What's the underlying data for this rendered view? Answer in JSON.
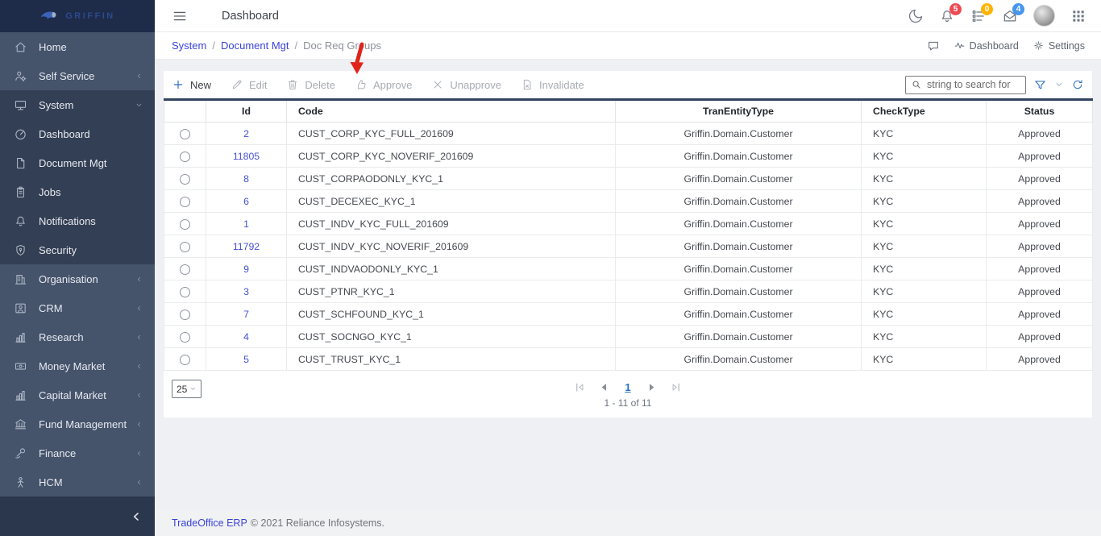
{
  "brand": {
    "name": "GRIFFIN"
  },
  "header": {
    "title": "Dashboard",
    "badges": {
      "notifications": "5",
      "tasks": "0",
      "messages": "4"
    }
  },
  "breadcrumb": {
    "separator": "/",
    "items": [
      {
        "label": "System",
        "link": true
      },
      {
        "label": "Document Mgt",
        "link": true
      },
      {
        "label": "Doc Req Groups",
        "link": false
      }
    ]
  },
  "quick_links": {
    "dashboard": "Dashboard",
    "settings": "Settings"
  },
  "toolbar": {
    "buttons": [
      {
        "label": "New",
        "icon": "plus-icon",
        "enabled": true
      },
      {
        "label": "Edit",
        "icon": "pencil-icon",
        "enabled": false
      },
      {
        "label": "Delete",
        "icon": "trash-icon",
        "enabled": false
      },
      {
        "label": "Approve",
        "icon": "thumbs-up-icon",
        "enabled": false
      },
      {
        "label": "Unapprove",
        "icon": "x-icon",
        "enabled": false
      },
      {
        "label": "Invalidate",
        "icon": "file-x-icon",
        "enabled": false
      }
    ],
    "search_placeholder": "string to search for"
  },
  "table": {
    "columns": [
      "",
      "Id",
      "Code",
      "TranEntityType",
      "CheckType",
      "Status"
    ],
    "rows": [
      {
        "id": "2",
        "code": "CUST_CORP_KYC_FULL_201609",
        "tran_entity_type": "Griffin.Domain.Customer",
        "check_type": "KYC",
        "status": "Approved"
      },
      {
        "id": "11805",
        "code": "CUST_CORP_KYC_NOVERIF_201609",
        "tran_entity_type": "Griffin.Domain.Customer",
        "check_type": "KYC",
        "status": "Approved"
      },
      {
        "id": "8",
        "code": "CUST_CORPAODONLY_KYC_1",
        "tran_entity_type": "Griffin.Domain.Customer",
        "check_type": "KYC",
        "status": "Approved"
      },
      {
        "id": "6",
        "code": "CUST_DECEXEC_KYC_1",
        "tran_entity_type": "Griffin.Domain.Customer",
        "check_type": "KYC",
        "status": "Approved"
      },
      {
        "id": "1",
        "code": "CUST_INDV_KYC_FULL_201609",
        "tran_entity_type": "Griffin.Domain.Customer",
        "check_type": "KYC",
        "status": "Approved"
      },
      {
        "id": "11792",
        "code": "CUST_INDV_KYC_NOVERIF_201609",
        "tran_entity_type": "Griffin.Domain.Customer",
        "check_type": "KYC",
        "status": "Approved"
      },
      {
        "id": "9",
        "code": "CUST_INDVAODONLY_KYC_1",
        "tran_entity_type": "Griffin.Domain.Customer",
        "check_type": "KYC",
        "status": "Approved"
      },
      {
        "id": "3",
        "code": "CUST_PTNR_KYC_1",
        "tran_entity_type": "Griffin.Domain.Customer",
        "check_type": "KYC",
        "status": "Approved"
      },
      {
        "id": "7",
        "code": "CUST_SCHFOUND_KYC_1",
        "tran_entity_type": "Griffin.Domain.Customer",
        "check_type": "KYC",
        "status": "Approved"
      },
      {
        "id": "4",
        "code": "CUST_SOCNGO_KYC_1",
        "tran_entity_type": "Griffin.Domain.Customer",
        "check_type": "KYC",
        "status": "Approved"
      },
      {
        "id": "5",
        "code": "CUST_TRUST_KYC_1",
        "tran_entity_type": "Griffin.Domain.Customer",
        "check_type": "KYC",
        "status": "Approved"
      }
    ]
  },
  "pagination": {
    "page_size": "25",
    "current_page": "1",
    "range_text": "1 - 11 of 11"
  },
  "footer": {
    "link": "TradeOffice ERP",
    "text": "© 2021 Reliance Infosystems."
  },
  "sidebar": {
    "items": [
      {
        "label": "Home",
        "icon": "home-icon",
        "chevron": null,
        "in_group": false
      },
      {
        "label": "Self Service",
        "icon": "user-gear-icon",
        "chevron": "left",
        "in_group": false
      },
      {
        "label": "System",
        "icon": "monitor-icon",
        "chevron": "down",
        "in_group": true
      },
      {
        "label": "Dashboard",
        "icon": "gauge-icon",
        "chevron": null,
        "in_group": true
      },
      {
        "label": "Document Mgt",
        "icon": "document-icon",
        "chevron": null,
        "in_group": true
      },
      {
        "label": "Jobs",
        "icon": "clipboard-icon",
        "chevron": null,
        "in_group": true
      },
      {
        "label": "Notifications",
        "icon": "bell-icon",
        "chevron": null,
        "in_group": true
      },
      {
        "label": "Security",
        "icon": "shield-icon",
        "chevron": null,
        "in_group": true
      },
      {
        "label": "Organisation",
        "icon": "building-icon",
        "chevron": "left",
        "in_group": false
      },
      {
        "label": "CRM",
        "icon": "user-card-icon",
        "chevron": "left",
        "in_group": false
      },
      {
        "label": "Research",
        "icon": "bar-chart-icon",
        "chevron": "left",
        "in_group": false
      },
      {
        "label": "Money Market",
        "icon": "banknote-icon",
        "chevron": "left",
        "in_group": false
      },
      {
        "label": "Capital Market",
        "icon": "bar-chart-icon",
        "chevron": "left",
        "in_group": false
      },
      {
        "label": "Fund Management",
        "icon": "bank-icon",
        "chevron": "left",
        "in_group": false
      },
      {
        "label": "Finance",
        "icon": "cash-flow-icon",
        "chevron": "left",
        "in_group": false
      },
      {
        "label": "HCM",
        "icon": "person-icon",
        "chevron": "left",
        "in_group": false
      }
    ]
  },
  "annotation": {
    "type": "red-arrow",
    "points_to": "New",
    "color": "#e0241b"
  },
  "colors": {
    "sidebar": "#45536b",
    "sidebar_group": "#333f54",
    "sidebar_header": "#1e2b49",
    "sidebar_footer": "#2b374d",
    "link_blue": "#3a43d6",
    "toolbar_blue": "#2a6cbd",
    "badge_red": "#ee4b55",
    "badge_yellow": "#ffb400",
    "badge_blue": "#4596ec",
    "table_top_border": "#31445f",
    "id_link": "#4750d4",
    "current_page_blue": "#2172c9"
  }
}
